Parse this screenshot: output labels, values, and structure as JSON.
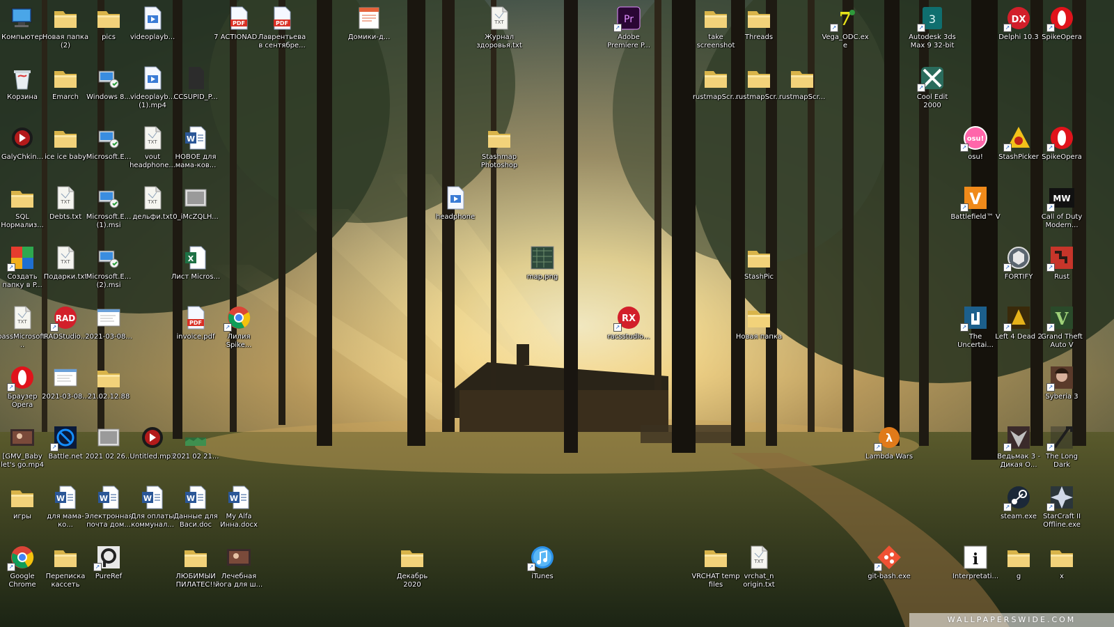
{
  "watermark": "WALLPAPERSWIDE.COM",
  "desktop": {
    "icons": [
      {
        "label": "Компьютер",
        "icon": "computer-icon",
        "col": 0,
        "row": 0,
        "shortcut": false
      },
      {
        "label": "Новая папка (2)",
        "icon": "folder-icon",
        "col": 1,
        "row": 0,
        "shortcut": false
      },
      {
        "label": "pics",
        "icon": "folder-icon",
        "col": 2,
        "row": 0,
        "shortcut": false
      },
      {
        "label": "videoplayb...",
        "icon": "media-file-icon",
        "col": 3,
        "row": 0,
        "shortcut": false
      },
      {
        "label": "7 ACTIONAD...",
        "icon": "pdf-icon",
        "col": 5,
        "row": 0,
        "shortcut": false
      },
      {
        "label": "Лаврентьева в сентябре...",
        "icon": "pdf-icon",
        "col": 6,
        "row": 0,
        "shortcut": false
      },
      {
        "label": "Домики-д...",
        "icon": "presentation-icon",
        "col": 8,
        "row": 0,
        "shortcut": false
      },
      {
        "label": "Журнал здоровья.txt",
        "icon": "txt-icon",
        "col": 11,
        "row": 0,
        "shortcut": false
      },
      {
        "label": "Adobe Premiere P...",
        "icon": "premiere-icon",
        "col": 14,
        "row": 0,
        "shortcut": true
      },
      {
        "label": "take screenshot",
        "icon": "folder-icon",
        "col": 16,
        "row": 0,
        "shortcut": false
      },
      {
        "label": "Threads",
        "icon": "folder-icon",
        "col": 17,
        "row": 0,
        "shortcut": false
      },
      {
        "label": "Vega_ODC.exe",
        "icon": "vega-icon",
        "col": 19,
        "row": 0,
        "shortcut": true
      },
      {
        "label": "Autodesk 3ds Max 9 32-bit",
        "icon": "3dsmax-icon",
        "col": 21,
        "row": 0,
        "shortcut": true
      },
      {
        "label": "Delphi 10.3",
        "icon": "delphi-icon",
        "col": 23,
        "row": 0,
        "shortcut": true
      },
      {
        "label": "SpikeOpera",
        "icon": "opera-icon",
        "col": 24,
        "row": 0,
        "shortcut": true
      },
      {
        "label": "Корзина",
        "icon": "recycle-bin-icon",
        "col": 0,
        "row": 1,
        "shortcut": false
      },
      {
        "label": "Emarch",
        "icon": "folder-icon",
        "col": 1,
        "row": 1,
        "shortcut": false
      },
      {
        "label": "Windows 8...",
        "icon": "installer-icon",
        "col": 2,
        "row": 1,
        "shortcut": false
      },
      {
        "label": "videoplayb... (1).mp4",
        "icon": "media-file-icon",
        "col": 3,
        "row": 1,
        "shortcut": false
      },
      {
        "label": "CCSUPID_P...",
        "icon": "blank-file-icon",
        "col": 4,
        "row": 1,
        "shortcut": false
      },
      {
        "label": "rustmapScr...",
        "icon": "folder-icon",
        "col": 16,
        "row": 1,
        "shortcut": false
      },
      {
        "label": "rustmapScr...",
        "icon": "folder-icon",
        "col": 17,
        "row": 1,
        "shortcut": false
      },
      {
        "label": "rustmapScr...",
        "icon": "folder-icon",
        "col": 18,
        "row": 1,
        "shortcut": false
      },
      {
        "label": "Cool Edit 2000",
        "icon": "cooledit-icon",
        "col": 21,
        "row": 1,
        "shortcut": true
      },
      {
        "label": "GalyChkin...",
        "icon": "mp3-icon",
        "col": 0,
        "row": 2,
        "shortcut": false
      },
      {
        "label": "ice ice baby",
        "icon": "folder-icon",
        "col": 1,
        "row": 2,
        "shortcut": false
      },
      {
        "label": "Microsoft.E...",
        "icon": "installer-icon",
        "col": 2,
        "row": 2,
        "shortcut": false
      },
      {
        "label": "vout headphone...",
        "icon": "txt-icon",
        "col": 3,
        "row": 2,
        "shortcut": false
      },
      {
        "label": "НОВОЕ для мама-ков...",
        "icon": "word-icon",
        "col": 4,
        "row": 2,
        "shortcut": false
      },
      {
        "label": "Stashmap Photoshop",
        "icon": "folder-icon",
        "col": 11,
        "row": 2,
        "shortcut": false
      },
      {
        "label": "osu!",
        "icon": "osu-icon",
        "col": 22,
        "row": 2,
        "shortcut": true
      },
      {
        "label": "StashPicker",
        "icon": "stashpicker-icon",
        "col": 23,
        "row": 2,
        "shortcut": true
      },
      {
        "label": "SpikeOpera",
        "icon": "opera-icon",
        "col": 24,
        "row": 2,
        "shortcut": true
      },
      {
        "label": "SQL Нормализ...",
        "icon": "folder-icon",
        "col": 0,
        "row": 3,
        "shortcut": false
      },
      {
        "label": "Debts.txt",
        "icon": "txt-icon",
        "col": 1,
        "row": 3,
        "shortcut": false
      },
      {
        "label": "Microsoft.E... (1).msi",
        "icon": "installer-icon",
        "col": 2,
        "row": 3,
        "shortcut": false
      },
      {
        "label": "дельфи.txt",
        "icon": "txt-icon",
        "col": 3,
        "row": 3,
        "shortcut": false
      },
      {
        "label": "0_iMcZQLH...",
        "icon": "image-file-icon",
        "col": 4,
        "row": 3,
        "shortcut": false
      },
      {
        "label": "headphone",
        "icon": "media-file-icon",
        "col": 10,
        "row": 3,
        "shortcut": false
      },
      {
        "label": "Battlefield™ V",
        "icon": "battlefield-icon",
        "col": 22,
        "row": 3,
        "shortcut": true
      },
      {
        "label": "Call of Duty Modern...",
        "icon": "cod-icon",
        "col": 24,
        "row": 3,
        "shortcut": true
      },
      {
        "label": "Создать папку в P...",
        "icon": "paint-icon",
        "col": 0,
        "row": 4,
        "shortcut": true
      },
      {
        "label": "Подарки.txt",
        "icon": "txt-icon",
        "col": 1,
        "row": 4,
        "shortcut": false
      },
      {
        "label": "Microsoft.E... (2).msi",
        "icon": "installer-icon",
        "col": 2,
        "row": 4,
        "shortcut": false
      },
      {
        "label": "Лист Micros...",
        "icon": "excel-icon",
        "col": 4,
        "row": 4,
        "shortcut": false
      },
      {
        "label": "map.png",
        "icon": "map-image-icon",
        "col": 12,
        "row": 4,
        "shortcut": false
      },
      {
        "label": "StashPic",
        "icon": "folder-icon",
        "col": 17,
        "row": 4,
        "shortcut": false
      },
      {
        "label": "FORTIFY",
        "icon": "fortify-icon",
        "col": 23,
        "row": 4,
        "shortcut": true
      },
      {
        "label": "Rust",
        "icon": "rust-icon",
        "col": 24,
        "row": 4,
        "shortcut": true
      },
      {
        "label": "passMicrosoft...",
        "icon": "txt-icon",
        "col": 0,
        "row": 5,
        "shortcut": false
      },
      {
        "label": "RADStudio...",
        "icon": "rad-icon",
        "col": 1,
        "row": 5,
        "shortcut": true
      },
      {
        "label": "2021-03-08...",
        "icon": "screenshot-icon",
        "col": 2,
        "row": 5,
        "shortcut": false
      },
      {
        "label": "invoice.pdf",
        "icon": "pdf-icon",
        "col": 4,
        "row": 5,
        "shortcut": false
      },
      {
        "label": "Лилия Spike...",
        "icon": "chrome-icon",
        "col": 5,
        "row": 5,
        "shortcut": true
      },
      {
        "label": "racsstudio...",
        "icon": "rx-icon",
        "col": 14,
        "row": 5,
        "shortcut": true
      },
      {
        "label": "Новая папка",
        "icon": "folder-icon",
        "col": 17,
        "row": 5,
        "shortcut": false
      },
      {
        "label": "The Uncertai...",
        "icon": "uncertain-icon",
        "col": 22,
        "row": 5,
        "shortcut": true
      },
      {
        "label": "Left 4 Dead 2",
        "icon": "l4d-icon",
        "col": 23,
        "row": 5,
        "shortcut": true
      },
      {
        "label": "Grand Theft Auto V",
        "icon": "gta-icon",
        "col": 24,
        "row": 5,
        "shortcut": true
      },
      {
        "label": "Браузер Opera",
        "icon": "opera-icon",
        "col": 0,
        "row": 6,
        "shortcut": true
      },
      {
        "label": "2021-03-08...",
        "icon": "screenshot-icon",
        "col": 1,
        "row": 6,
        "shortcut": false
      },
      {
        "label": "21.02.12.88",
        "icon": "folder-icon",
        "col": 2,
        "row": 6,
        "shortcut": false
      },
      {
        "label": "Syberia 3",
        "icon": "syberia-icon",
        "col": 24,
        "row": 6,
        "shortcut": true
      },
      {
        "label": "[GMV_Baby let's go.mp4",
        "icon": "video-thumb-icon",
        "col": 0,
        "row": 7,
        "shortcut": false
      },
      {
        "label": "Battle.net",
        "icon": "battlenet-icon",
        "col": 1,
        "row": 7,
        "shortcut": true
      },
      {
        "label": "2021 02 26...",
        "icon": "image-file-icon",
        "col": 2,
        "row": 7,
        "shortcut": false
      },
      {
        "label": "Untitled.mp3",
        "icon": "mp3-icon",
        "col": 3,
        "row": 7,
        "shortcut": false
      },
      {
        "label": "2021 02 21...",
        "icon": "green-image-icon",
        "col": 4,
        "row": 7,
        "shortcut": false
      },
      {
        "label": "Lambda Wars",
        "icon": "lambda-icon",
        "col": 20,
        "row": 7,
        "shortcut": true
      },
      {
        "label": "Ведьмак 3 - Дикая О...",
        "icon": "witcher-icon",
        "col": 23,
        "row": 7,
        "shortcut": true
      },
      {
        "label": "The Long Dark",
        "icon": "longdark-icon",
        "col": 24,
        "row": 7,
        "shortcut": true
      },
      {
        "label": "игры",
        "icon": "folder-icon",
        "col": 0,
        "row": 8,
        "shortcut": false
      },
      {
        "label": "для мама-ко...",
        "icon": "word-icon",
        "col": 1,
        "row": 8,
        "shortcut": false
      },
      {
        "label": "Электронная почта дом...",
        "icon": "word-icon",
        "col": 2,
        "row": 8,
        "shortcut": false
      },
      {
        "label": "Для оплаты коммунал...",
        "icon": "word-icon",
        "col": 3,
        "row": 8,
        "shortcut": false
      },
      {
        "label": "Данные для Васи.doc",
        "icon": "word-icon",
        "col": 4,
        "row": 8,
        "shortcut": false
      },
      {
        "label": "My Alfa Инна.docx",
        "icon": "word-icon",
        "col": 5,
        "row": 8,
        "shortcut": false
      },
      {
        "label": "steam.exe",
        "icon": "steam-icon",
        "col": 23,
        "row": 8,
        "shortcut": true
      },
      {
        "label": "StarCraft II Offline.exe",
        "icon": "starcraft-icon",
        "col": 24,
        "row": 8,
        "shortcut": true
      },
      {
        "label": "Google Chrome",
        "icon": "chrome-icon",
        "col": 0,
        "row": 9,
        "shortcut": true
      },
      {
        "label": "Переписка кассеть",
        "icon": "folder-icon",
        "col": 1,
        "row": 9,
        "shortcut": false
      },
      {
        "label": "PureRef",
        "icon": "pureref-icon",
        "col": 2,
        "row": 9,
        "shortcut": true
      },
      {
        "label": "ЛЮБИМЫЙ ПИЛАТЕС!!",
        "icon": "folder-icon",
        "col": 4,
        "row": 9,
        "shortcut": false
      },
      {
        "label": "Лечебная йога для ш...",
        "icon": "video-thumb-icon",
        "col": 5,
        "row": 9,
        "shortcut": false
      },
      {
        "label": "Декабрь 2020",
        "icon": "folder-icon",
        "col": 9,
        "row": 9,
        "shortcut": false
      },
      {
        "label": "iTunes",
        "icon": "itunes-icon",
        "col": 12,
        "row": 9,
        "shortcut": true
      },
      {
        "label": "VRCHAT temp files",
        "icon": "folder-icon",
        "col": 16,
        "row": 9,
        "shortcut": false
      },
      {
        "label": "vrchat_n origin.txt",
        "icon": "txt-icon",
        "col": 17,
        "row": 9,
        "shortcut": false
      },
      {
        "label": "git-bash.exe",
        "icon": "git-icon",
        "col": 20,
        "row": 9,
        "shortcut": true
      },
      {
        "label": "Interpretati...",
        "icon": "info-icon",
        "col": 22,
        "row": 9,
        "shortcut": false
      },
      {
        "label": "g",
        "icon": "folder-icon",
        "col": 23,
        "row": 9,
        "shortcut": false
      },
      {
        "label": "x",
        "icon": "folder-icon",
        "col": 24,
        "row": 9,
        "shortcut": false
      }
    ]
  }
}
